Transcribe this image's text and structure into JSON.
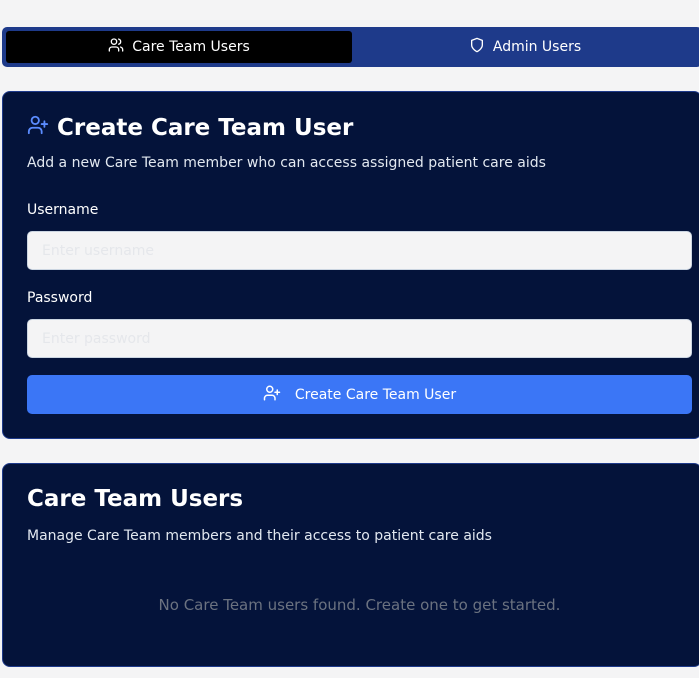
{
  "tabs": [
    {
      "label": "Care Team Users",
      "icon": "users-icon",
      "active": true
    },
    {
      "label": "Admin Users",
      "icon": "shield-icon",
      "active": false
    }
  ],
  "create_card": {
    "title": "Create Care Team User",
    "title_icon": "user-plus-icon",
    "description": "Add a new Care Team member who can access assigned patient care aids",
    "username": {
      "label": "Username",
      "value": "",
      "placeholder": "Enter username"
    },
    "password": {
      "label": "Password",
      "value": "",
      "placeholder": "Enter password"
    },
    "submit_label": "Create Care Team User",
    "submit_icon": "user-plus-icon"
  },
  "list_card": {
    "title": "Care Team Users",
    "description": "Manage Care Team members and their access to patient care aids",
    "empty_message": "No Care Team users found. Create one to get started."
  },
  "colors": {
    "page_bg": "#f4f4f5",
    "tab_bar": "#1e3a8a",
    "tab_active": "#000000",
    "card_bg": "#04133a",
    "accent_button": "#3b76f6",
    "title_icon": "#5b8cff"
  }
}
